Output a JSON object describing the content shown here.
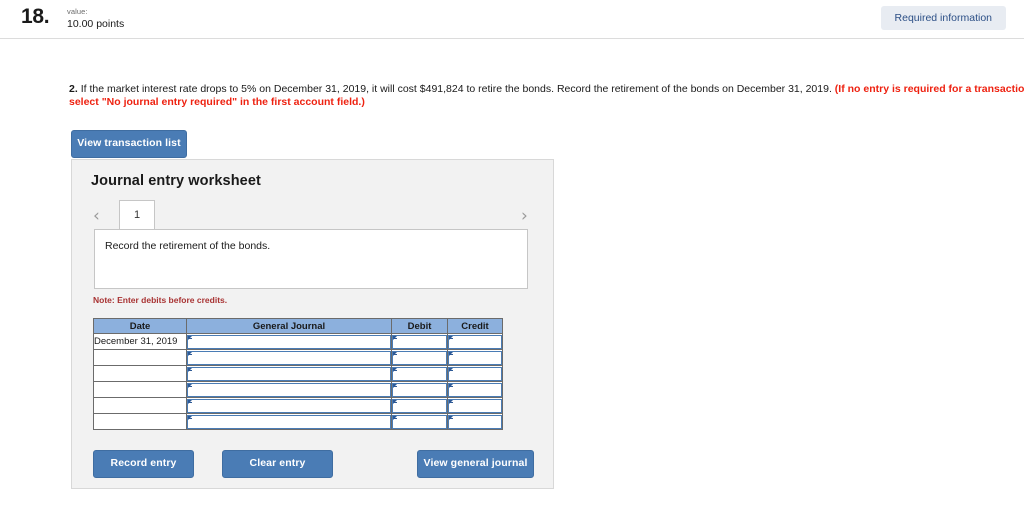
{
  "header": {
    "question_number": "18.",
    "value_label": "value:",
    "points": "10.00 points",
    "required_badge": "Required information"
  },
  "question": {
    "marker": "2.",
    "body": "If the market interest rate drops to 5% on December 31, 2019, it will cost $491,824 to retire the bonds. Record the retirement of the bonds on December 31, 2019.",
    "red_note": "(If no entry is required for a transaction/event, select \"No journal entry required\" in the first account field.)"
  },
  "toolbar": {
    "view_transaction_list": "View transaction list"
  },
  "worksheet": {
    "title": "Journal entry worksheet",
    "pager": {
      "prev_icon": "chevron-left",
      "next_icon": "chevron-right",
      "tabs": [
        "1"
      ],
      "active_tab": "1"
    },
    "instruction": "Record the retirement of the bonds.",
    "note": "Note: Enter debits before credits.",
    "table": {
      "columns": [
        "Date",
        "General Journal",
        "Debit",
        "Credit"
      ],
      "rows": [
        {
          "date": "December 31, 2019",
          "general_journal": "",
          "debit": "",
          "credit": ""
        },
        {
          "date": "",
          "general_journal": "",
          "debit": "",
          "credit": ""
        },
        {
          "date": "",
          "general_journal": "",
          "debit": "",
          "credit": ""
        },
        {
          "date": "",
          "general_journal": "",
          "debit": "",
          "credit": ""
        },
        {
          "date": "",
          "general_journal": "",
          "debit": "",
          "credit": ""
        },
        {
          "date": "",
          "general_journal": "",
          "debit": "",
          "credit": ""
        }
      ]
    },
    "buttons": {
      "record_entry": "Record entry",
      "clear_entry": "Clear entry",
      "view_general_journal": "View general journal"
    }
  },
  "colors": {
    "button_blue": "#4a7cb5",
    "table_header_blue": "#8cb0dd",
    "panel_gray": "#f2f2f2",
    "note_red": "#a83232",
    "question_red": "#ee2211",
    "badge_bg": "#e8ecf2",
    "badge_text": "#2c4f86"
  }
}
